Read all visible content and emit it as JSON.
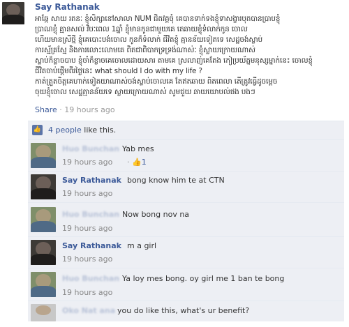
{
  "post": {
    "author": "Say Rathanak",
    "text_lines": [
      "អាឆ្កែ សាយ រតនៈ ខ្ញុំសិក្សានៅសាលា NUM ជិតវគ្គចុំ គេបានទាក់ទងខ្ញុំទាសង្ខារបុតបានប្រាបខ្ញុំ",
      "ប្រាណខ្ញុំ គ្មានសល់ វិបៈពេល 1ឆ្នាំ ខ្ញុំមានកូនជាមួយគេ តេឆាយខ្ញុំទំលាក់កូន ចោល",
      "ហើយមានស្រីថ្មី ខ្ញុំគេបោះបង់ចោល កូនក៏ទំលាក់ ជីវិតខ្ញុំ គ្មានន័យទៀតទេ សេដ្ឋចង់ស្លាប់",
      "ការស្ម័គ្រស្មែ និងការលោះលោមគេ ពិតជាពិបាកទ្រទ្រង់ណាស់ៈ ខ្ញុំស្លាយក្រោយណាស់",
      "ស្លាប់ក៏ខ្លាចបាប ខ្ញុំចាំក៏ខ្លាចគេចោលដោយសារ តាមគេ ស្រលាញ់គេតែង កៀប្រយ័ត្នមនុស្សម្នាក់នេះ ចោលខ្ញុំ",
      "ជីវិតចាប់ផ្តើមពីរថ្ងៃនេះ what should I do with my life ?",
      "កាត់ត្រួតចិត្តគេហាក់ទៀតយាណាស់ចង់ស្លាប់ចោលគេ តែឥតឆាយ ពិតពេលា តើត្រូវធ្វើដូចម្តេច",
      "ចុយខ្ញុំចោល សេដ្ឋគ្មានន័យទេ ស្លាយក្រោយណាស់ សូមជួយ ឆាយយោបល់ផង បងៗ"
    ],
    "share_label": "Share",
    "separator": "·",
    "time": "19 hours ago"
  },
  "likes": {
    "count_text": "4 people",
    "suffix": "like this."
  },
  "comments": [
    {
      "author": "Huo Bunchan",
      "text": "Yab mes",
      "time": "19 hours ago",
      "likes_sep": "·",
      "likes": "1",
      "author_blurred": true
    },
    {
      "author": "Say Rathanak",
      "text": "bong know him te at CTN",
      "time": "19 hours ago",
      "author_blurred": false
    },
    {
      "author": "Huo Bunchan",
      "text": "Now bong nov na",
      "time": "19 hours ago",
      "author_blurred": true
    },
    {
      "author": "Say Rathanak",
      "text": "m a girl",
      "time": "19 hours ago",
      "author_blurred": false
    },
    {
      "author": "Huo Bunchan",
      "text": "Ya loy mes bong. oy girl me 1 ban te bong",
      "time": "19 hours ago",
      "author_blurred": true
    },
    {
      "author": "Oko Nat ana",
      "text": "you do like this, what's ur benefit?",
      "author_blurred": true
    }
  ],
  "colors": {
    "link": "#3b5998",
    "feedback_bg": "#edeff4",
    "muted": "#999999"
  }
}
